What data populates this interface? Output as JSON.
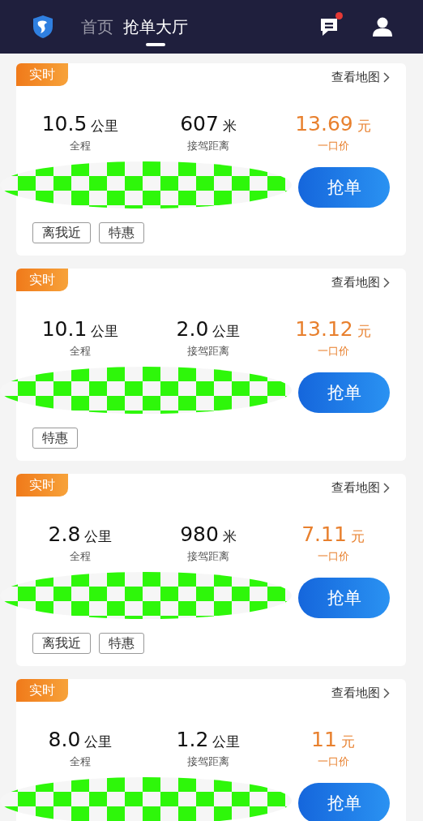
{
  "header": {
    "tabs": [
      {
        "label": "首页",
        "selected": false
      },
      {
        "label": "抢单大厅",
        "selected": true
      }
    ],
    "messages": {
      "unread": true
    }
  },
  "orders": [
    {
      "badge": "实时",
      "map_link": "查看地图",
      "stats": [
        {
          "value": "10.5",
          "unit": "公里",
          "label": "全程"
        },
        {
          "value": "607",
          "unit": "米",
          "label": "接驾距离"
        }
      ],
      "price": {
        "value": "13.69",
        "unit": "元",
        "label": "一口价"
      },
      "redacted": true,
      "button": "抢单",
      "tags": [
        "离我近",
        "特惠"
      ]
    },
    {
      "badge": "实时",
      "map_link": "查看地图",
      "stats": [
        {
          "value": "10.1",
          "unit": "公里",
          "label": "全程"
        },
        {
          "value": "2.0",
          "unit": "公里",
          "label": "接驾距离"
        }
      ],
      "price": {
        "value": "13.12",
        "unit": "元",
        "label": "一口价"
      },
      "redacted": true,
      "button": "抢单",
      "tags": [
        "特惠"
      ]
    },
    {
      "badge": "实时",
      "map_link": "查看地图",
      "stats": [
        {
          "value": "2.8",
          "unit": "公里",
          "label": "全程"
        },
        {
          "value": "980",
          "unit": "米",
          "label": "接驾距离"
        }
      ],
      "price": {
        "value": "7.11",
        "unit": "元",
        "label": "一口价"
      },
      "redacted": true,
      "button": "抢单",
      "tags": [
        "离我近",
        "特惠"
      ]
    },
    {
      "badge": "实时",
      "map_link": "查看地图",
      "stats": [
        {
          "value": "8.0",
          "unit": "公里",
          "label": "全程"
        },
        {
          "value": "1.2",
          "unit": "公里",
          "label": "接驾距离"
        }
      ],
      "price": {
        "value": "11",
        "unit": "元",
        "label": "一口价"
      },
      "redacted": true,
      "button": "抢单"
    }
  ]
}
